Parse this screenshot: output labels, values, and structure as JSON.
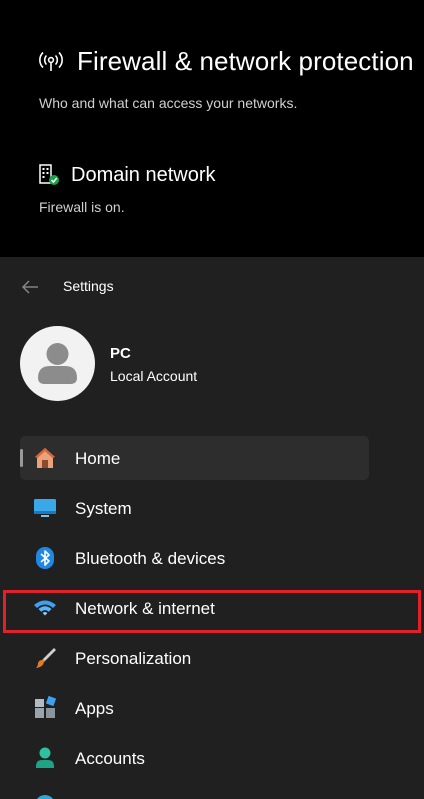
{
  "firewall": {
    "title": "Firewall & network protection",
    "subtitle": "Who and what can access your networks.",
    "title_icon": "antenna-icon",
    "domain": {
      "title": "Domain network",
      "status": "Firewall is on.",
      "icon": "domain-network-icon"
    }
  },
  "settings": {
    "app_title": "Settings",
    "back_icon": "back-arrow-icon",
    "account": {
      "name": "PC",
      "type": "Local Account"
    },
    "nav": [
      {
        "label": "Home",
        "icon": "home-icon",
        "selected": true
      },
      {
        "label": "System",
        "icon": "system-icon",
        "selected": false
      },
      {
        "label": "Bluetooth & devices",
        "icon": "bluetooth-icon",
        "selected": false
      },
      {
        "label": "Network & internet",
        "icon": "wifi-icon",
        "selected": false,
        "highlighted": true
      },
      {
        "label": "Personalization",
        "icon": "brush-icon",
        "selected": false
      },
      {
        "label": "Apps",
        "icon": "apps-icon",
        "selected": false
      },
      {
        "label": "Accounts",
        "icon": "accounts-icon",
        "selected": false
      }
    ]
  },
  "colors": {
    "settings_bg": "#202020",
    "selected_bg": "#2d2d2d",
    "highlight": "#e0202a",
    "accent_blue": "#3fa0f0"
  }
}
